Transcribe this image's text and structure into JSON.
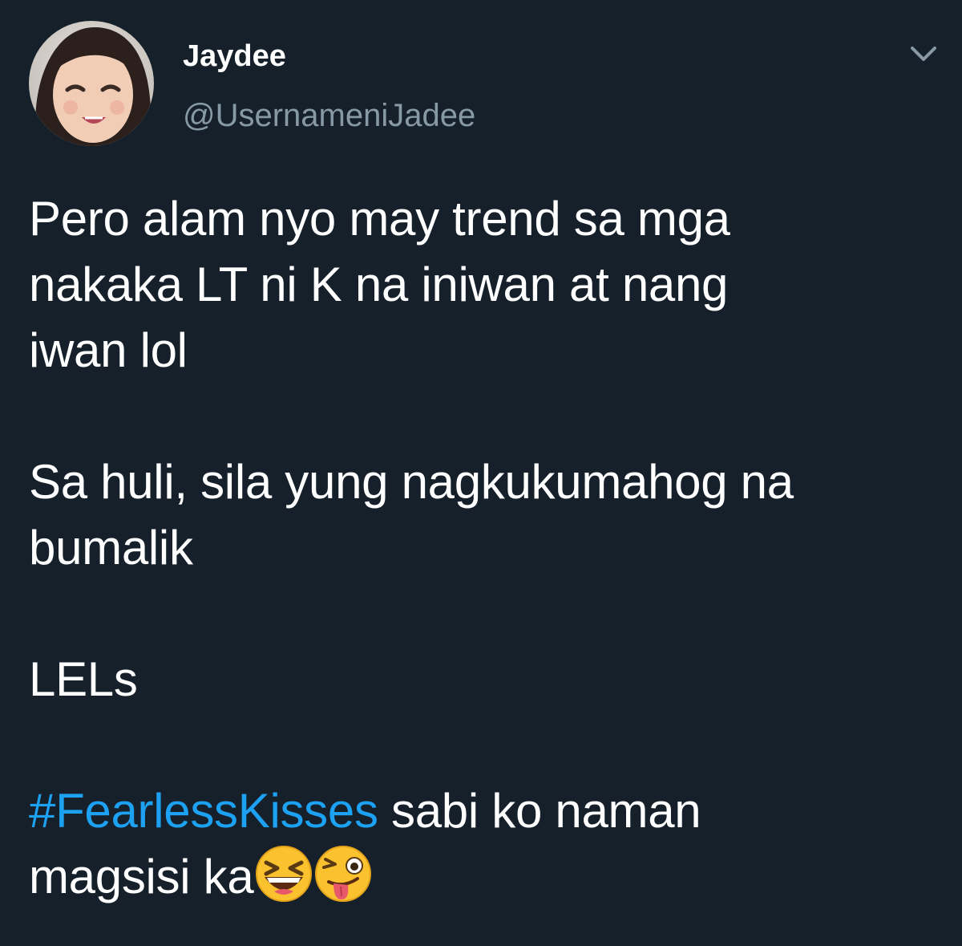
{
  "tweet": {
    "author": {
      "display_name": "Jaydee",
      "handle": "@UsernameniJadee",
      "avatar_icon": "profile-photo"
    },
    "menu_icon": "chevron-down-icon",
    "paragraphs": [
      {
        "lines": [
          "Pero alam nyo may trend sa mga",
          "nakaka LT ni K na iniwan at nang",
          "iwan lol"
        ]
      },
      {
        "lines": [
          "Sa huli, sila yung nagkukumahog na",
          "bumalik"
        ]
      },
      {
        "lines": [
          "LELs"
        ]
      }
    ],
    "last_paragraph": {
      "hashtag": "#FearlessKisses",
      "text_after_hashtag": " sabi ko naman",
      "line2": "magsisi ka",
      "emojis": [
        "laughing-squinting-face",
        "winking-face-with-tongue"
      ]
    }
  },
  "colors": {
    "background": "#15202b",
    "text": "#ffffff",
    "secondary_text": "#8899a6",
    "link": "#1da1f2"
  }
}
